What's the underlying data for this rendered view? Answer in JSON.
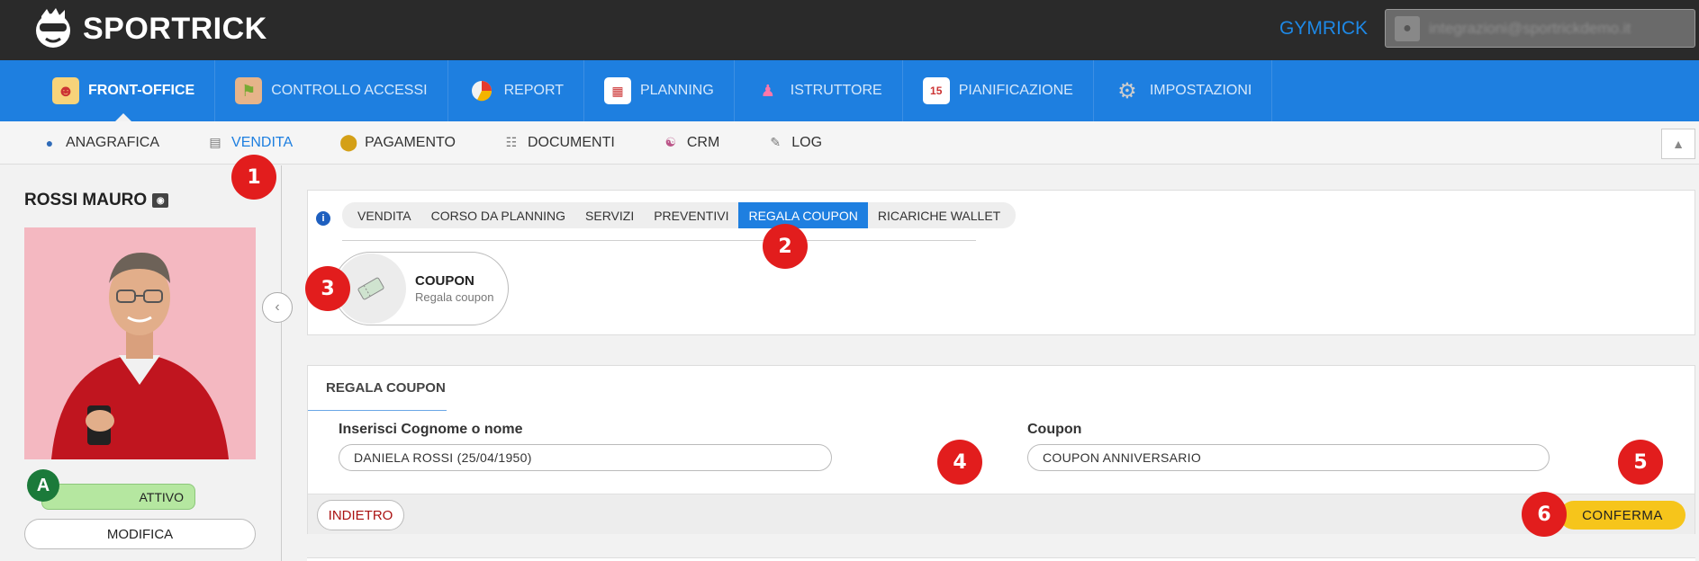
{
  "header": {
    "app_name": "SPORTRICK",
    "gym_name": "GYMRICK",
    "user_email": "integrazioni@sportrickdemo.it"
  },
  "main_nav": [
    {
      "label": "FRONT-OFFICE",
      "icon": "front-office-icon",
      "active": true
    },
    {
      "label": "CONTROLLO ACCESSI",
      "icon": "access-control-icon"
    },
    {
      "label": "REPORT",
      "icon": "pie-chart-icon"
    },
    {
      "label": "PLANNING",
      "icon": "calendar-grid-icon"
    },
    {
      "label": "ISTRUTTORE",
      "icon": "instructor-icon"
    },
    {
      "label": "PIANIFICAZIONE",
      "icon": "calendar-icon"
    },
    {
      "label": "IMPOSTAZIONI",
      "icon": "gear-icon"
    }
  ],
  "sub_nav": [
    {
      "label": "ANAGRAFICA",
      "icon": "person-icon"
    },
    {
      "label": "VENDITA",
      "icon": "cash-register-icon",
      "active": true
    },
    {
      "label": "PAGAMENTO",
      "icon": "coin-icon"
    },
    {
      "label": "DOCUMENTI",
      "icon": "document-icon"
    },
    {
      "label": "CRM",
      "icon": "handshake-icon"
    },
    {
      "label": "LOG",
      "icon": "log-icon"
    }
  ],
  "profile": {
    "name": "ROSSI MAURO",
    "status_letter": "A",
    "status_text": "ATTIVO",
    "edit_label": "MODIFICA"
  },
  "sale_tabs": [
    "VENDITA",
    "CORSO DA PLANNING",
    "SERVIZI",
    "PREVENTIVI",
    "REGALA COUPON",
    "RICARICHE WALLET"
  ],
  "active_sale_tab": "REGALA COUPON",
  "coupon_card": {
    "title": "COUPON",
    "subtitle": "Regala coupon"
  },
  "form": {
    "header": "REGALA COUPON",
    "name_label": "Inserisci Cognome o nome",
    "name_value": "DANIELA  ROSSI  (25/04/1950)",
    "coupon_label": "Coupon",
    "coupon_value": "COUPON ANNIVERSARIO",
    "back_label": "INDIETRO",
    "confirm_label": "CONFERMA"
  },
  "badges": [
    "1",
    "2",
    "3",
    "4",
    "5",
    "6"
  ],
  "colors": {
    "topbar": "#2a2a2a",
    "nav_blue": "#1e7fe0",
    "badge_red": "#e21d1d",
    "confirm_yellow": "#f6c51b",
    "status_green": "#b5e7a0"
  }
}
